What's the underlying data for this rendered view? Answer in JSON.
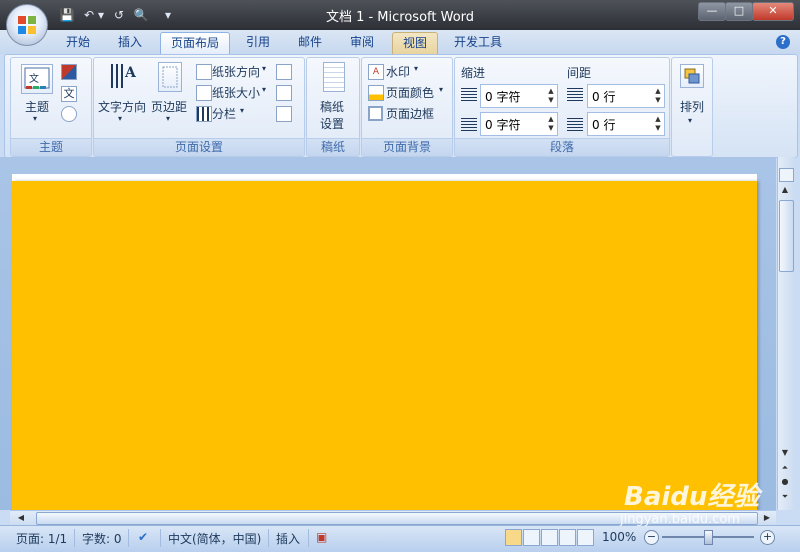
{
  "window": {
    "title": "文档 1 - Microsoft Word",
    "controls": {
      "minimize": "—",
      "maximize": "□",
      "close": "✕"
    }
  },
  "quick_access": {
    "save": "💾",
    "undo": "↶",
    "undo_dropdown": "▾",
    "redo": "↺",
    "print_preview": "🔍",
    "customize": "▾"
  },
  "tabs": [
    {
      "label": "开始"
    },
    {
      "label": "插入"
    },
    {
      "label": "页面布局"
    },
    {
      "label": "引用"
    },
    {
      "label": "邮件"
    },
    {
      "label": "审阅"
    },
    {
      "label": "视图"
    },
    {
      "label": "开发工具"
    }
  ],
  "active_tab": "页面布局",
  "help": "?",
  "ribbon": {
    "themes": {
      "group_label": "主题",
      "themes_button": "主题",
      "dropdown": "▾"
    },
    "page_setup": {
      "group_label": "页面设置",
      "text_direction": "文字方向",
      "margins": "页边距",
      "orientation": "纸张方向",
      "size": "纸张大小",
      "columns": "分栏",
      "dropdown": "▾",
      "launcher": "↘"
    },
    "manuscript": {
      "group_label": "稿纸",
      "settings_line1": "稿纸",
      "settings_line2": "设置"
    },
    "page_background": {
      "group_label": "页面背景",
      "watermark": "水印",
      "page_color": "页面颜色",
      "page_borders": "页面边框",
      "dropdown": "▾"
    },
    "paragraph": {
      "group_label": "段落",
      "indent_label": "缩进",
      "spacing_label": "间距",
      "indent_left": "0 字符",
      "indent_right": "0 字符",
      "spacing_before": "0 行",
      "spacing_after": "0 行",
      "spin_up": "▲",
      "spin_down": "▼",
      "launcher": "↘"
    },
    "arrange": {
      "label": "排列",
      "dropdown": "▾"
    }
  },
  "document": {
    "page_color": "#ffc000"
  },
  "scroll": {
    "up": "▲",
    "down": "▼",
    "left": "◀",
    "right": "▶",
    "prev_page": "⏶",
    "select_browse": "●",
    "next_page": "⏷"
  },
  "status": {
    "page": "页面: 1/1",
    "words": "字数: 0",
    "proofing": "✔",
    "language": "中文(简体，中国)",
    "mode": "插入",
    "macro": "▣",
    "zoom": "100%",
    "zoom_out": "−",
    "zoom_in": "+"
  },
  "watermark_brand": {
    "text": "Baidu经验",
    "url": "jingyan.baidu.com"
  }
}
